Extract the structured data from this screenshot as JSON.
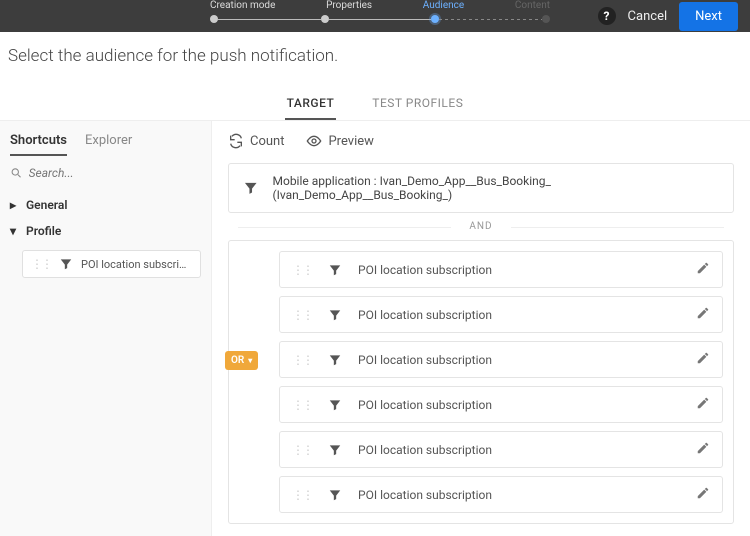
{
  "stepper": {
    "steps": [
      "Creation mode",
      "Properties",
      "Audience",
      "Content"
    ]
  },
  "topbar": {
    "help": "?",
    "cancel": "Cancel",
    "next": "Next"
  },
  "heading": "Select the audience for the push notification.",
  "tabs": {
    "target": "TARGET",
    "test_profiles": "TEST PROFILES"
  },
  "sidebar": {
    "tabs": {
      "shortcuts": "Shortcuts",
      "explorer": "Explorer"
    },
    "search_placeholder": "Search...",
    "groups": {
      "general": "General",
      "profile": "Profile"
    },
    "profile_item": "POI location subscriptio…"
  },
  "toolbar": {
    "count": "Count",
    "preview": "Preview"
  },
  "app_row": {
    "prefix": "Mobile application : ",
    "value": "Ivan_Demo_App__Bus_Booking_ (Ivan_Demo_App__Bus_Booking_)"
  },
  "and_label": "AND",
  "or_label": "OR",
  "rules": [
    "POI location subscription",
    "POI location subscription",
    "POI location subscription",
    "POI location subscription",
    "POI location subscription",
    "POI location subscription"
  ]
}
